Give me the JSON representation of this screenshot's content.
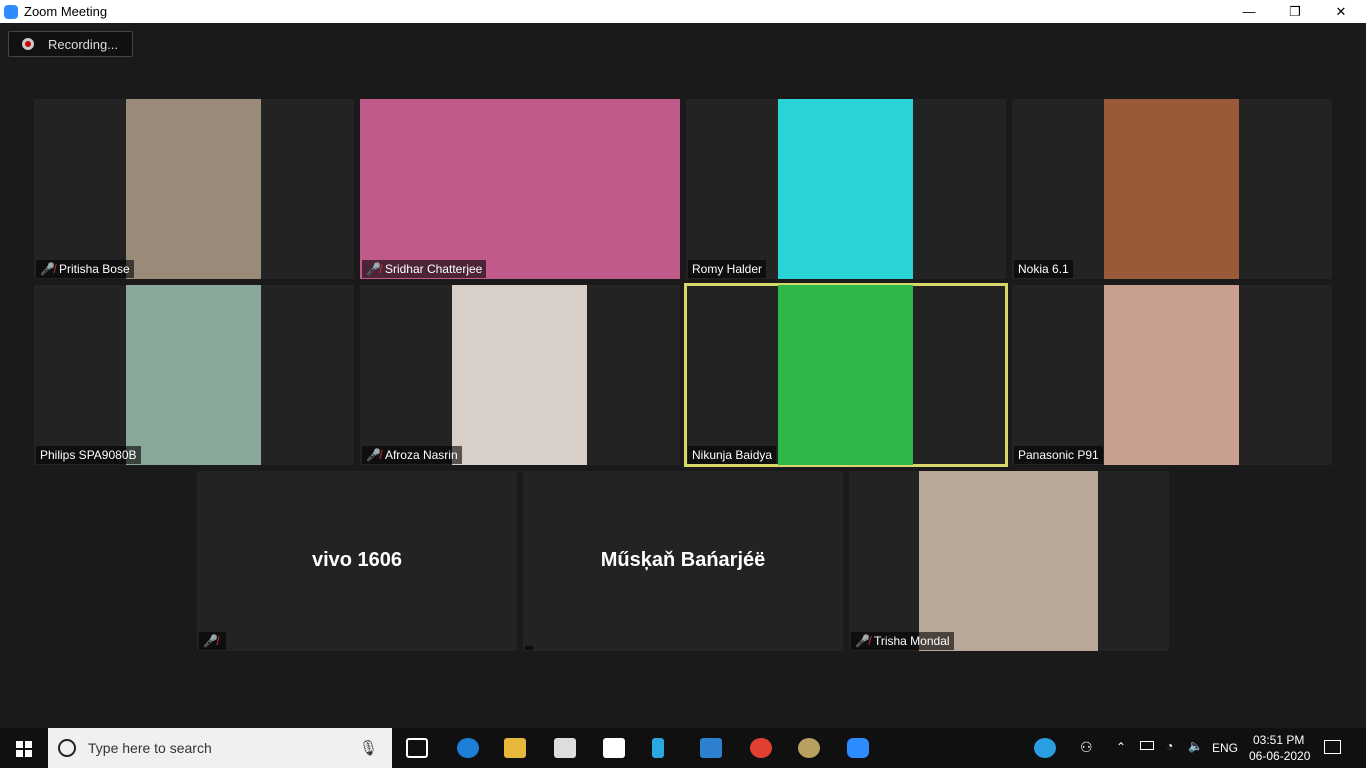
{
  "window": {
    "title": "Zoom Meeting",
    "minimize": "—",
    "maximize": "❐",
    "close": "✕"
  },
  "recording": {
    "label": "Recording..."
  },
  "participants": [
    {
      "name": "Pritisha Bose",
      "muted": true,
      "video": true,
      "color": "#9a8a7a"
    },
    {
      "name": "Sridhar Chatterjee",
      "muted": true,
      "video": true,
      "color": "#c05a8a"
    },
    {
      "name": "Romy Halder",
      "muted": false,
      "video": true,
      "color": "#2ad3d6"
    },
    {
      "name": "Nokia 6.1",
      "muted": false,
      "video": true,
      "color": "#9a5a3a"
    },
    {
      "name": "Philips SPA9080B",
      "muted": false,
      "video": true,
      "color": "#8aa89a"
    },
    {
      "name": "Afroza Nasrin",
      "muted": true,
      "video": true,
      "color": "#d8d0c8"
    },
    {
      "name": "Nikunja Baidya",
      "muted": false,
      "video": true,
      "active": true,
      "color": "#2fb84a"
    },
    {
      "name": "Panasonic P91",
      "muted": false,
      "video": true,
      "color": "#c9a090"
    },
    {
      "name": "vivo 1606",
      "muted": true,
      "video": false
    },
    {
      "name": "Műsķaň Bańarjéë",
      "muted": false,
      "video": false
    },
    {
      "name": "Trisha Mondal",
      "muted": true,
      "video": true,
      "color": "#b8a898"
    }
  ],
  "taskbar": {
    "search_placeholder": "Type here to search",
    "language": "ENG",
    "time": "03:51 PM",
    "date": "06-06-2020"
  }
}
